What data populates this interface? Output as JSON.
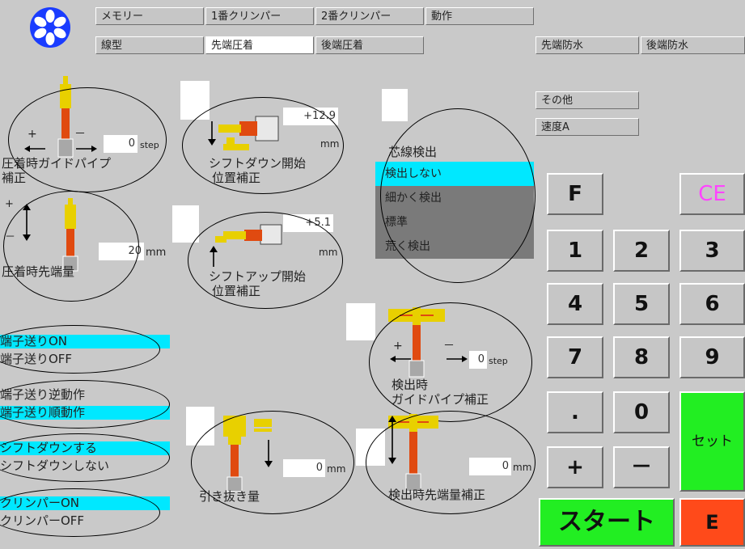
{
  "top_tabs": {
    "row1": [
      "メモリー",
      "1番クリンパー",
      "2番クリンパー",
      "動作"
    ],
    "row2": [
      "線型",
      "先端圧着",
      "後端圧着"
    ],
    "right": [
      "先端防水",
      "後端防水"
    ]
  },
  "side_buttons": [
    "その他",
    "速度A"
  ],
  "crimp_guide": {
    "label1": "圧着時ガイドパイプ",
    "label2": "補正",
    "value": "0",
    "unit": "step",
    "plus": "+",
    "minus": "－"
  },
  "crimp_tip": {
    "label": "圧着時先端量",
    "value": "20",
    "unit": "mm",
    "plus": "+",
    "minus": "－"
  },
  "shift_down": {
    "label1": "シフトダウン開始",
    "label2": "位置補正",
    "value": "+12.9",
    "unit": "mm"
  },
  "shift_up": {
    "label1": "シフトアップ開始",
    "label2": "位置補正",
    "value": "+5.1",
    "unit": "mm"
  },
  "core_detect": {
    "title": "芯線検出",
    "options": [
      "検出しない",
      "細かく検出",
      "標準",
      "荒く検出"
    ],
    "selected": 0
  },
  "detect_guide": {
    "label1": "検出時",
    "label2": "ガイドパイプ補正",
    "value": "0",
    "unit": "step",
    "plus": "+",
    "minus": "－"
  },
  "detect_tip": {
    "label": "検出時先端量補正",
    "value": "0",
    "unit": "mm"
  },
  "pull_out": {
    "label": "引き抜き量",
    "value": "0",
    "unit": "mm"
  },
  "toggles": {
    "terminal_feed": {
      "on": "端子送りON",
      "off": "端子送りOFF",
      "selected": "on"
    },
    "feed_direction": {
      "reverse": "端子送り逆動作",
      "forward": "端子送り順動作",
      "selected": "forward"
    },
    "shift_down": {
      "on": "シフトダウンする",
      "off": "シフトダウンしない",
      "selected": "on"
    },
    "crimper": {
      "on": "クリンパーON",
      "off": "クリンパーOFF",
      "selected": "on"
    }
  },
  "keypad": {
    "f": "F",
    "ce": "CE",
    "digits": [
      "1",
      "2",
      "3",
      "4",
      "5",
      "6",
      "7",
      "8",
      "9"
    ],
    "dot": ".",
    "zero": "0",
    "plus": "+",
    "minus": "－",
    "set": "セット",
    "start": "スタート",
    "e": "E"
  },
  "colors": {
    "bg": "#c9c9c9",
    "cyan": "#00e8ff",
    "green": "#22ee22",
    "red": "#ff4a1a",
    "magenta": "#ff44ff",
    "yellow": "#e8d000",
    "copper": "#e04a10"
  }
}
